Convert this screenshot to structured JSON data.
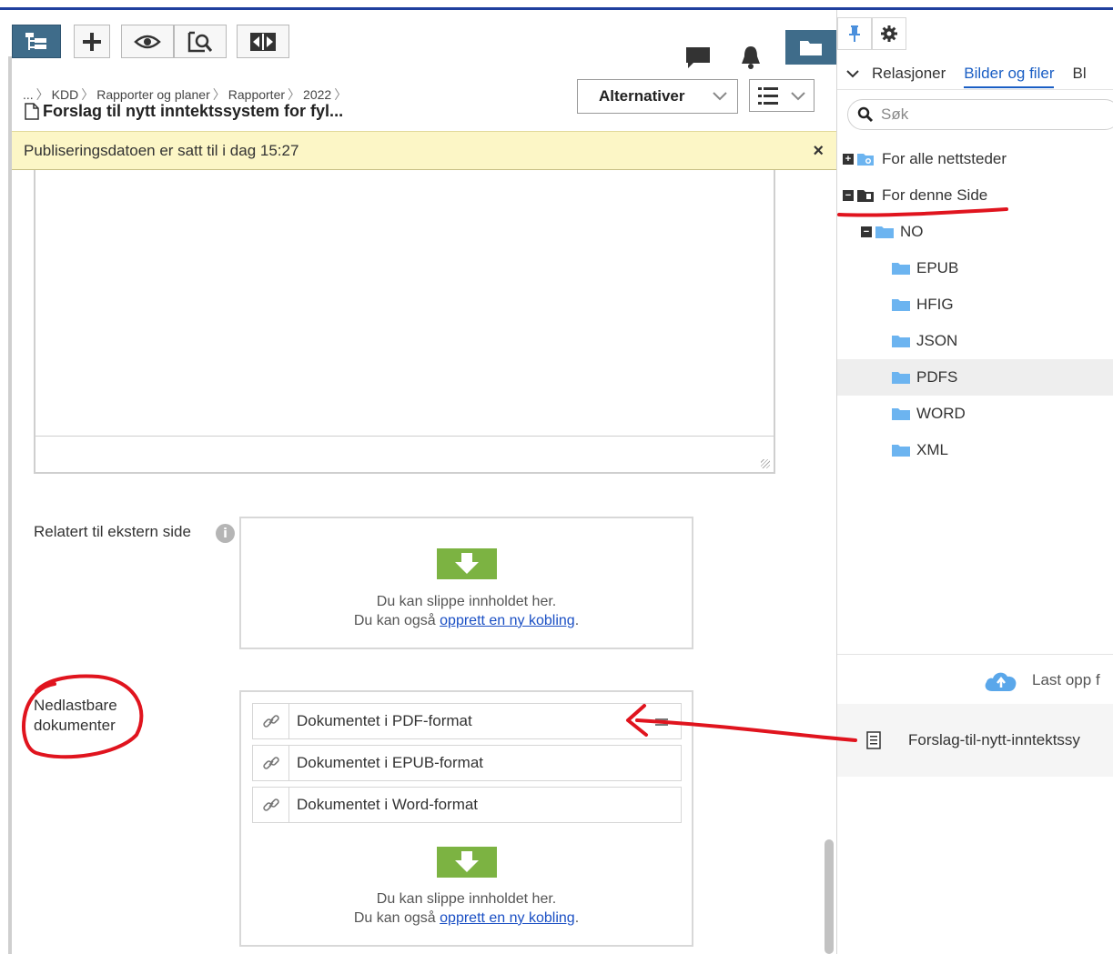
{
  "breadcrumb": [
    "...",
    "KDD",
    "Rapporter og planer",
    "Rapporter",
    "2022"
  ],
  "page_title": "Forslag til nytt inntektssystem for fyl...",
  "options_button": "Alternativer",
  "banner_text": "Publiseringsdatoen er satt til i dag 15:27",
  "close_glyph": "×",
  "related_field": {
    "label": "Relatert til ekstern side",
    "drop_text": "Du kan slippe innholdet her.",
    "also_prefix": "Du kan også ",
    "link_text": "opprett en ny kobling",
    "suffix": "."
  },
  "downloads_field": {
    "label": "Nedlastbare dokumenter",
    "items": [
      "Dokumentet i PDF-format",
      "Dokumentet i EPUB-format",
      "Dokumentet i Word-format"
    ],
    "drop_text": "Du kan slippe innholdet her.",
    "also_prefix": "Du kan også ",
    "link_text": "opprett en ny kobling",
    "suffix": "."
  },
  "info_glyph": "i",
  "right_pane": {
    "tabs": [
      "Relasjoner",
      "Bilder og filer",
      "Bl"
    ],
    "active_tab": 1,
    "search_placeholder": "Søk",
    "tree": {
      "for_all_sites": "For alle nettsteder",
      "for_this_page": "For denne Side",
      "no_folder": "NO",
      "subfolders": [
        "EPUB",
        "HFIG",
        "JSON",
        "PDFS",
        "WORD",
        "XML"
      ],
      "selected_subfolder": "PDFS"
    },
    "upload_text": "Last opp f",
    "file_name": "Forslag-til-nytt-inntektssy"
  },
  "colors": {
    "accent_blue": "#1a5ec4",
    "toolbar_active": "#3f6c8a",
    "banner_bg": "#fcf6c6",
    "drop_green": "#7cb342",
    "annotation_red": "#e0141e",
    "folder_blue": "#6cb4f0"
  }
}
